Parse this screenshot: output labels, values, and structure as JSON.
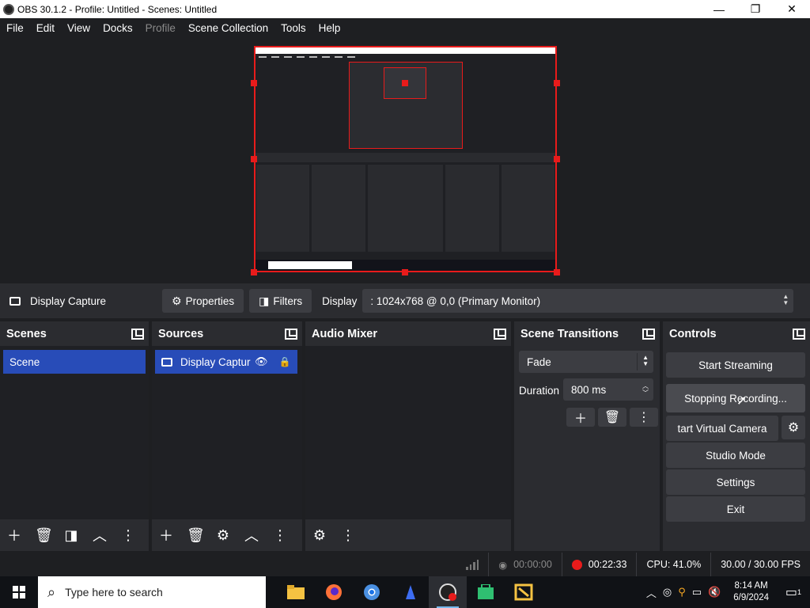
{
  "window": {
    "title": "OBS 30.1.2 - Profile: Untitled - Scenes: Untitled",
    "minimize": "—",
    "maximize": "❐",
    "close": "✕"
  },
  "menu": [
    "File",
    "Edit",
    "View",
    "Docks",
    "Profile",
    "Scene Collection",
    "Tools",
    "Help"
  ],
  "source_toolbar": {
    "source_name": "Display Capture",
    "properties": "Properties",
    "filters": "Filters",
    "display_label": "Display",
    "display_value": ": 1024x768 @ 0,0 (Primary Monitor)"
  },
  "docks": {
    "scenes": {
      "title": "Scenes",
      "items": [
        "Scene"
      ]
    },
    "sources": {
      "title": "Sources",
      "items": [
        "Display Captur"
      ]
    },
    "audio_mixer": {
      "title": "Audio Mixer"
    },
    "transitions": {
      "title": "Scene Transitions",
      "selected": "Fade",
      "duration_label": "Duration",
      "duration_value": "800 ms"
    },
    "controls": {
      "title": "Controls",
      "start_streaming": "Start Streaming",
      "stopping_recording": "Stopping Recording...",
      "start_virtual_camera": "tart Virtual Camera",
      "studio_mode": "Studio Mode",
      "settings": "Settings",
      "exit": "Exit"
    }
  },
  "status": {
    "stream_time": "00:00:00",
    "rec_time": "00:22:33",
    "cpu": "CPU: 41.0%",
    "fps": "30.00 / 30.00 FPS"
  },
  "taskbar": {
    "search_placeholder": "Type here to search",
    "time": "8:14 AM",
    "date": "6/9/2024",
    "notification_count": "1"
  },
  "colors": {
    "accent": "#284cb8",
    "record": "#e81b1b",
    "panel": "#2b2c30",
    "background": "#1e1f22"
  }
}
